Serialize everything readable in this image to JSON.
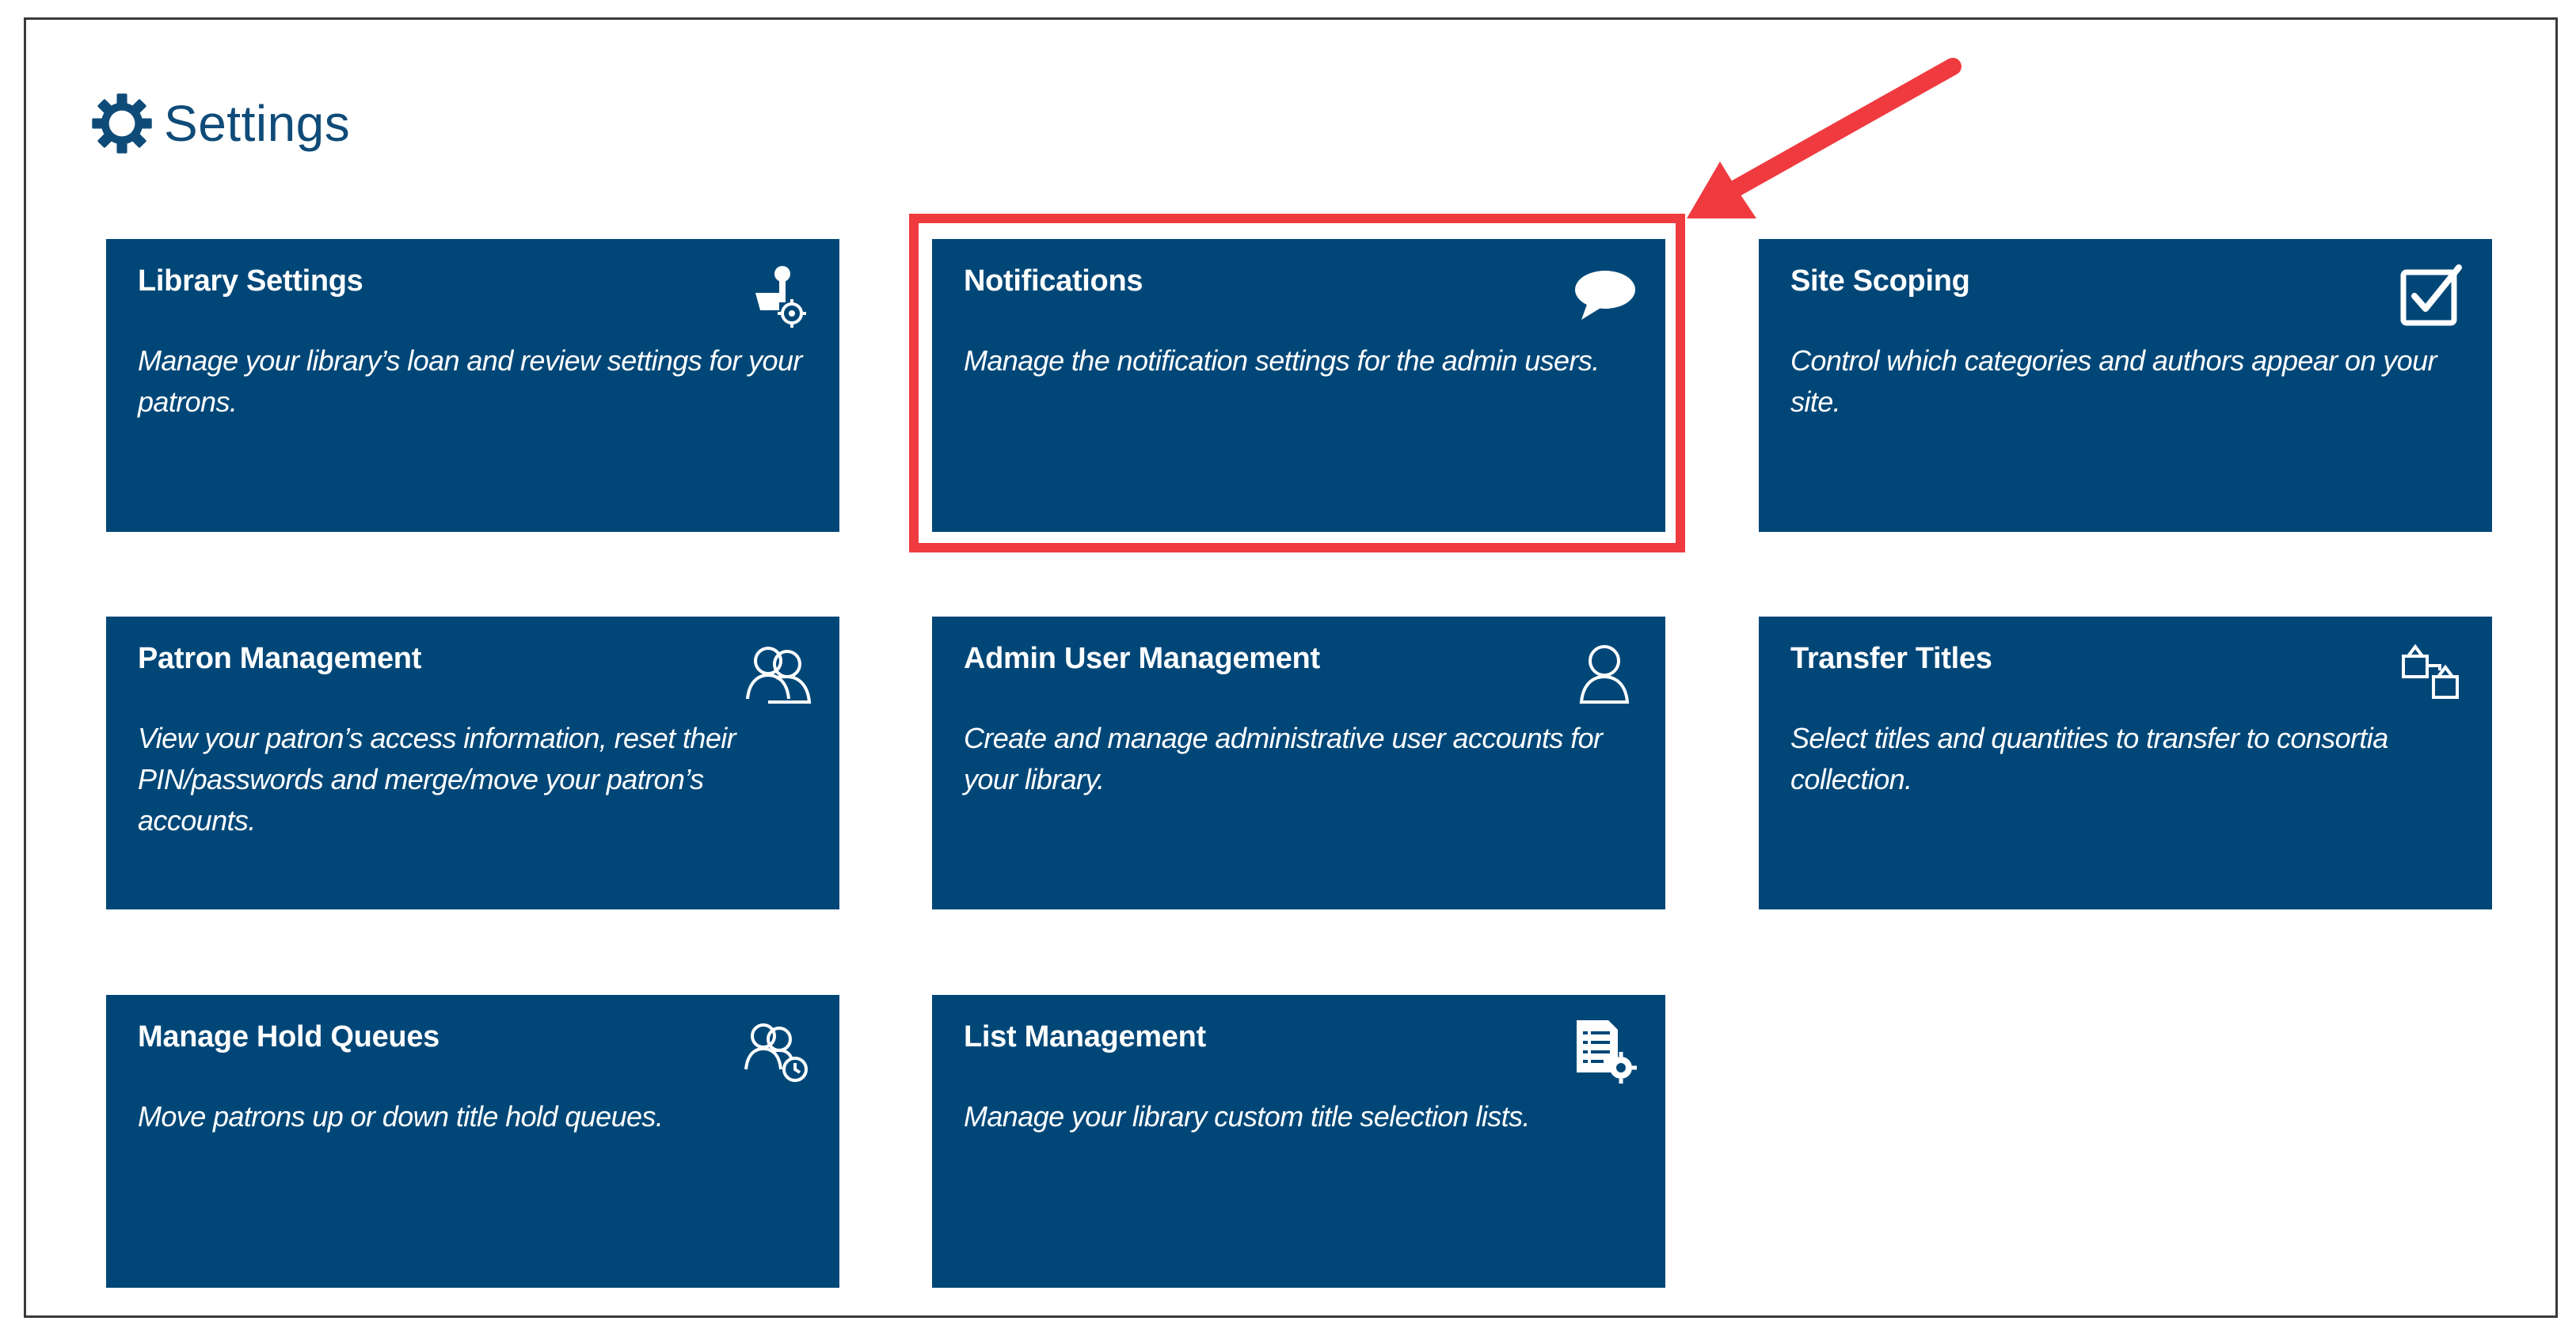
{
  "page": {
    "title": "Settings",
    "icon": "gear-icon"
  },
  "tiles": [
    {
      "title": "Library Settings",
      "description": "Manage your library’s loan and review settings for your patrons.",
      "icon": "library-settings-icon"
    },
    {
      "title": "Notifications",
      "description": "Manage the notification settings for the admin users.",
      "icon": "speech-bubble-icon"
    },
    {
      "title": "Site Scoping",
      "description": "Control which categories and authors appear on your site.",
      "icon": "checkbox-checked-icon"
    },
    {
      "title": "Patron Management",
      "description": "View your patron’s access information, reset their PIN/passwords and merge/move your patron’s accounts.",
      "icon": "users-icon"
    },
    {
      "title": "Admin User Management",
      "description": "Create and manage administrative user accounts for your library.",
      "icon": "user-icon"
    },
    {
      "title": "Transfer Titles",
      "description": "Select titles and quantities to transfer to consortia collection.",
      "icon": "transfer-icon"
    },
    {
      "title": "Manage Hold Queues",
      "description": "Move patrons up or down title hold queues.",
      "icon": "hold-queue-icon"
    },
    {
      "title": "List Management",
      "description": "Manage your library custom title selection lists.",
      "icon": "list-settings-icon"
    }
  ],
  "colors": {
    "tile_background": "#004778",
    "header_text": "#0f4b78",
    "highlight": "#ef3b3f",
    "frame_border": "#3a3a3a"
  }
}
